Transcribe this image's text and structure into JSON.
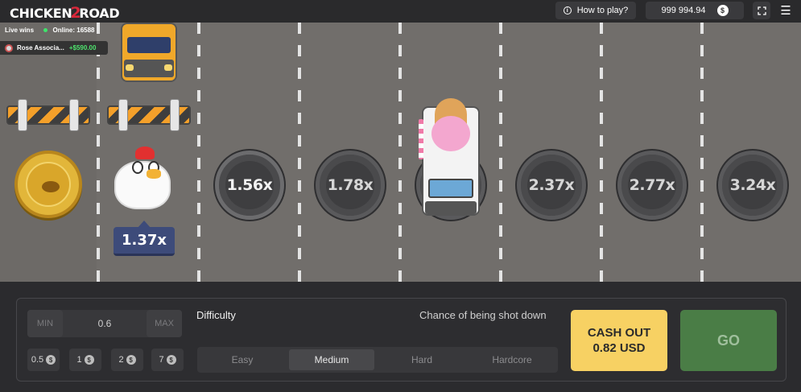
{
  "header": {
    "logo_part1": "CHICKEN",
    "logo_part2": "2",
    "logo_part3": "ROAD",
    "how_to_play": "How to play?",
    "balance": "999 994.94",
    "currency_symbol": "$",
    "info_icon": "i",
    "menu_icon": "☰"
  },
  "live": {
    "label": "Live wins",
    "online_label": "Online: 16588",
    "latest_user": "Rose Associa...",
    "latest_amount": "+$590.00"
  },
  "road": {
    "current_multiplier": "1.37x",
    "next_multipliers": [
      "1.56x",
      "1.78x",
      "2.37x",
      "2.77x",
      "3.24x"
    ]
  },
  "controls": {
    "min_label": "MIN",
    "bet_value": "0.6",
    "max_label": "MAX",
    "quick_bets": [
      "0.5",
      "1",
      "2",
      "7"
    ],
    "difficulty_label": "Difficulty",
    "chance_label": "Chance of being shot down",
    "difficulties": [
      "Easy",
      "Medium",
      "Hard",
      "Hardcore"
    ],
    "selected_difficulty": "Medium",
    "cashout_line1": "CASH OUT",
    "cashout_line2": "0.82 USD",
    "go_label": "GO"
  },
  "colors": {
    "road": "#716e6b",
    "cashout": "#f7d163",
    "go": "#4a7d46",
    "multiplier_tag": "#3d4b7a"
  }
}
